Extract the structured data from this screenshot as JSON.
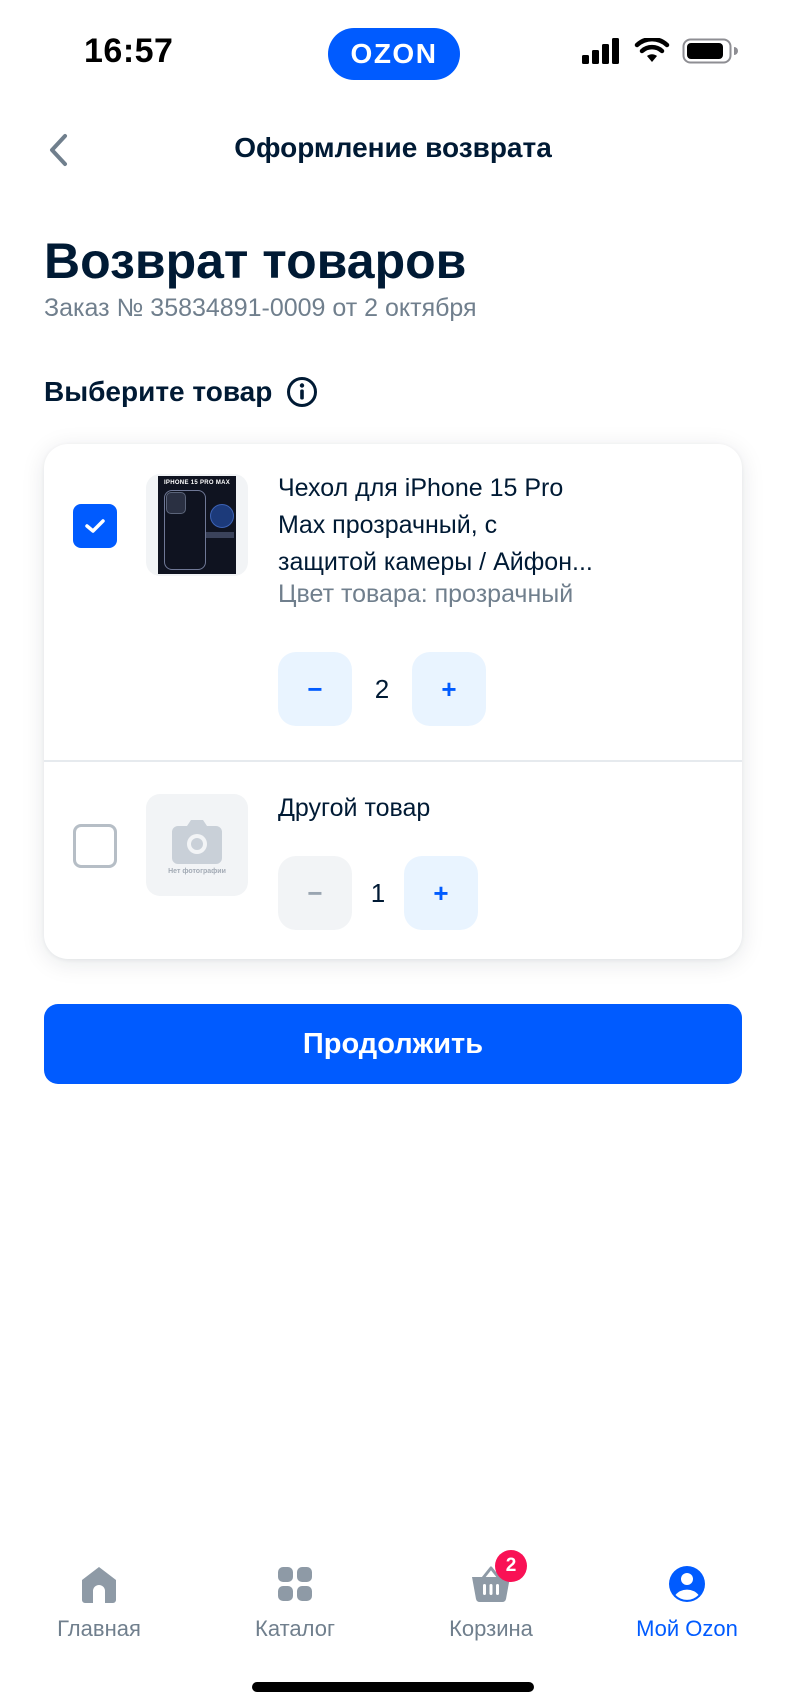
{
  "status_bar": {
    "time": "16:57",
    "brand": "OZON"
  },
  "header": {
    "title": "Оформление возврата"
  },
  "page": {
    "title": "Возврат товаров",
    "order_info": "Заказ № 35834891-0009 от 2 октября",
    "section_label": "Выберите товар"
  },
  "items": [
    {
      "title": "Чехол для iPhone 15 Pro Max прозрачный, с защитой камеры / Айфон...",
      "color_info": "Цвет товара: прозрачный",
      "quantity": "2",
      "checked": true,
      "thumb_text": "IPHONE 15 PRO MAX",
      "minus": "−",
      "plus": "+"
    },
    {
      "title": "Другой товар",
      "quantity": "1",
      "checked": false,
      "thumb_text": "Нет фотографии",
      "minus": "−",
      "plus": "+"
    }
  ],
  "continue_label": "Продолжить",
  "tabs": [
    {
      "label": "Главная",
      "icon": "home-icon"
    },
    {
      "label": "Каталог",
      "icon": "catalog-icon"
    },
    {
      "label": "Корзина",
      "icon": "cart-icon",
      "badge": "2"
    },
    {
      "label": "Мой Ozon",
      "icon": "profile-icon",
      "active": true
    }
  ],
  "colors": {
    "accent": "#005bff",
    "text": "#001a34",
    "muted": "#707f8d",
    "badge": "#f91155"
  }
}
